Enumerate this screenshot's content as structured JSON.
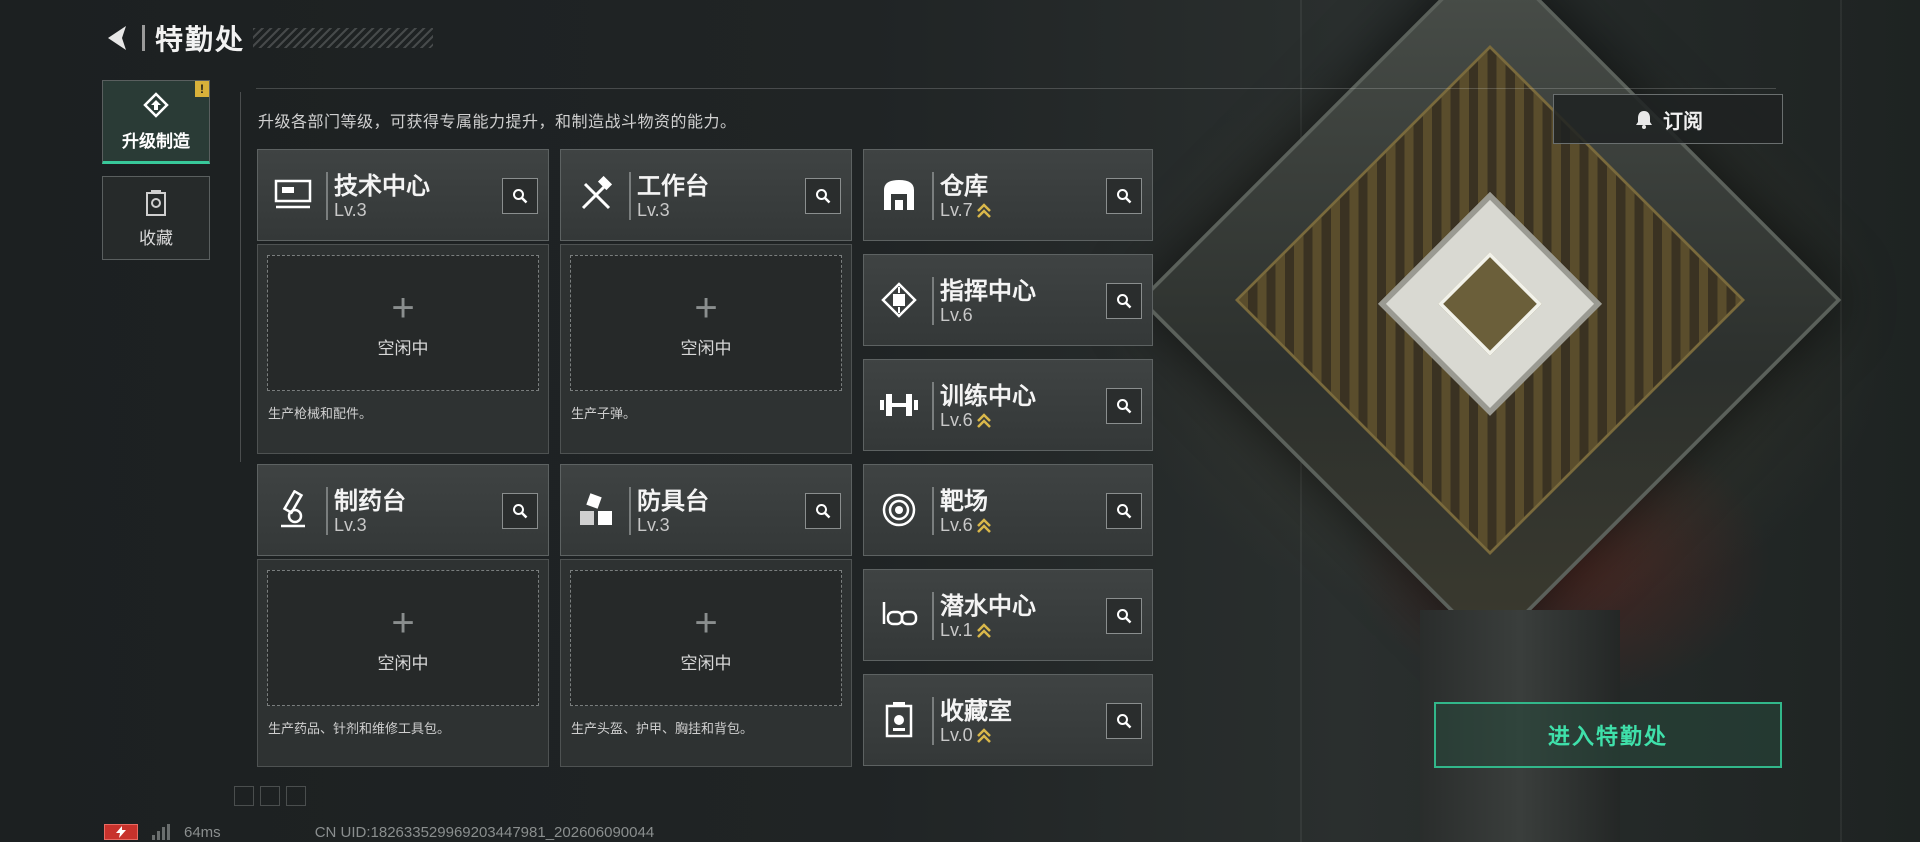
{
  "header": {
    "title": "特勤处"
  },
  "side_tabs": [
    {
      "label": "升级制造",
      "active": true,
      "alert": "!"
    },
    {
      "label": "收藏",
      "active": false
    }
  ],
  "description": "升级各部门等级，可获得专属能力提升，和制造战斗物资的能力。",
  "subscribe_label": "订阅",
  "departments": [
    {
      "name": "技术中心",
      "level": "Lv.3",
      "upgrade": false,
      "icon": "tech-center-icon"
    },
    {
      "name": "工作台",
      "level": "Lv.3",
      "upgrade": false,
      "icon": "workbench-icon"
    },
    {
      "name": "仓库",
      "level": "Lv.7",
      "upgrade": true,
      "icon": "warehouse-icon"
    },
    {
      "name": "指挥中心",
      "level": "Lv.6",
      "upgrade": false,
      "icon": "command-center-icon"
    },
    {
      "name": "训练中心",
      "level": "Lv.6",
      "upgrade": true,
      "icon": "training-center-icon"
    },
    {
      "name": "制药台",
      "level": "Lv.3",
      "upgrade": false,
      "icon": "pharmacy-icon"
    },
    {
      "name": "防具台",
      "level": "Lv.3",
      "upgrade": false,
      "icon": "armor-bench-icon"
    },
    {
      "name": "靶场",
      "level": "Lv.6",
      "upgrade": true,
      "icon": "shooting-range-icon"
    },
    {
      "name": "潜水中心",
      "level": "Lv.1",
      "upgrade": true,
      "icon": "diving-center-icon"
    },
    {
      "name": "收藏室",
      "level": "Lv.0",
      "upgrade": true,
      "icon": "collection-room-icon"
    }
  ],
  "slots": [
    {
      "status": "空闲中",
      "desc": "生产枪械和配件。"
    },
    {
      "status": "空闲中",
      "desc": "生产子弹。"
    },
    {
      "status": "空闲中",
      "desc": "生产药品、针剂和维修工具包。"
    },
    {
      "status": "空闲中",
      "desc": "生产头盔、护甲、胸挂和背包。"
    }
  ],
  "enter_button": "进入特勤处",
  "footer": {
    "ping": "64ms",
    "uid": "CN UID:182633529969203447981_202606090044"
  },
  "colors": {
    "accent": "#3fe0aa",
    "upgrade": "#d9b84a",
    "alert": "#d8b13a",
    "battery": "#c8322c"
  }
}
